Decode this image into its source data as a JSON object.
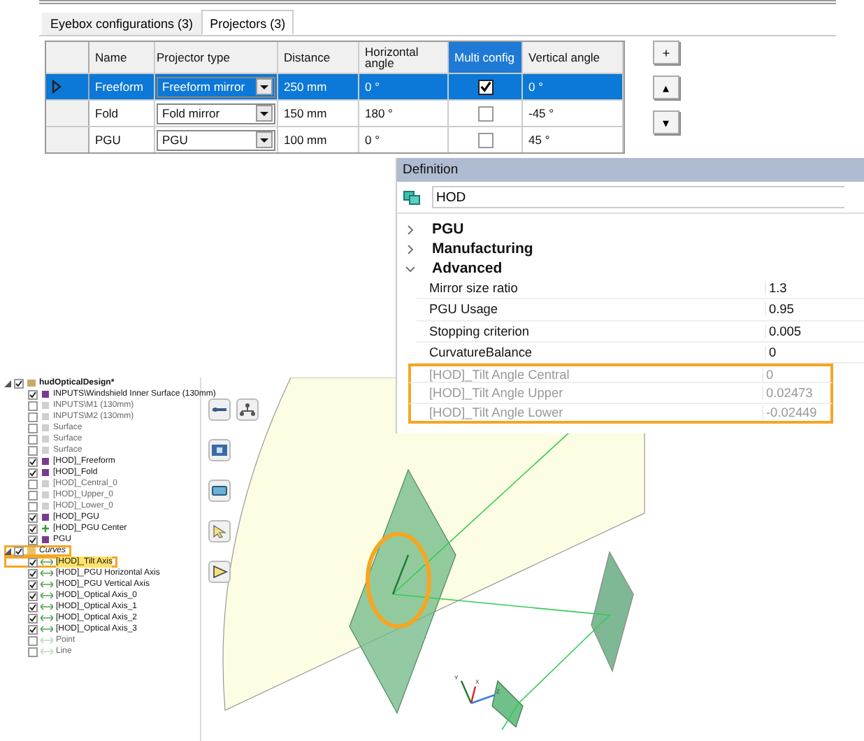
{
  "projectors_panel": {
    "tabs": [
      {
        "label": "Eyebox configurations (3)",
        "selected": false
      },
      {
        "label": "Projectors (3)",
        "selected": true
      }
    ],
    "columns": [
      {
        "label": "Name",
        "selected": false
      },
      {
        "label": "Projector type",
        "selected": false
      },
      {
        "label": "Distance",
        "selected": false
      },
      {
        "label": "Horizontal angle",
        "selected": false
      },
      {
        "label": "Multi config",
        "selected": true
      },
      {
        "label": "Vertical angle",
        "selected": false
      }
    ],
    "rows": [
      {
        "selected": true,
        "name": "Freeform",
        "type": "Freeform mirror",
        "distance": "250 mm",
        "horizontal_angle": "0 °",
        "multi_config": true,
        "vertical_angle": "0 °"
      },
      {
        "selected": false,
        "name": "Fold",
        "type": "Fold mirror",
        "distance": "150 mm",
        "horizontal_angle": "180 °",
        "multi_config": false,
        "vertical_angle": "-45 °"
      },
      {
        "selected": false,
        "name": "PGU",
        "type": "PGU",
        "distance": "100 mm",
        "horizontal_angle": "0 °",
        "multi_config": false,
        "vertical_angle": "45 °"
      }
    ],
    "side_buttons": [
      "+",
      "▴",
      "▾"
    ]
  },
  "definition_panel": {
    "title": "Definition",
    "name_field": "HOD",
    "groups": [
      {
        "label": "PGU",
        "expanded": false
      },
      {
        "label": "Manufacturing",
        "expanded": false
      },
      {
        "label": "Advanced",
        "expanded": true,
        "properties": [
          {
            "label": "Mirror size ratio",
            "value": "1.3",
            "disabled": false,
            "highlighted": false
          },
          {
            "label": "PGU Usage",
            "value": "0.95",
            "disabled": false,
            "highlighted": false
          },
          {
            "label": "Stopping criterion",
            "value": "0.005",
            "disabled": false,
            "highlighted": false
          },
          {
            "label": "CurvatureBalance",
            "value": "0",
            "disabled": false,
            "highlighted": false
          },
          {
            "label": "[HOD]_Tilt Angle Central",
            "value": "0",
            "disabled": true,
            "highlighted": true
          },
          {
            "label": "[HOD]_Tilt Angle Upper",
            "value": "0.02473",
            "disabled": true,
            "highlighted": true
          },
          {
            "label": "[HOD]_Tilt Angle Lower",
            "value": "-0.02449",
            "disabled": true,
            "highlighted": true
          }
        ]
      }
    ]
  },
  "tree": [
    {
      "label": "hudOpticalDesign*",
      "checked": true,
      "expanded": true,
      "kind": "document",
      "selected": false,
      "highlighted": false,
      "children": [
        {
          "label": "INPUTS\\Windshield Inner Surface (130mm)",
          "checked": true,
          "kind": "surface",
          "selected": false,
          "highlighted": false
        },
        {
          "label": "INPUTS\\M1 (130mm)",
          "checked": false,
          "kind": "surface",
          "selected": false,
          "highlighted": false
        },
        {
          "label": "INPUTS\\M2 (130mm)",
          "checked": false,
          "kind": "surface",
          "selected": false,
          "highlighted": false
        },
        {
          "label": "Surface",
          "checked": false,
          "kind": "surface",
          "selected": false,
          "highlighted": false
        },
        {
          "label": "Surface",
          "checked": false,
          "kind": "surface",
          "selected": false,
          "highlighted": false
        },
        {
          "label": "Surface",
          "checked": false,
          "kind": "surface",
          "selected": false,
          "highlighted": false
        },
        {
          "label": "[HOD]_Freeform",
          "checked": true,
          "kind": "surface",
          "selected": false,
          "highlighted": false
        },
        {
          "label": "[HOD]_Fold",
          "checked": true,
          "kind": "surface",
          "selected": false,
          "highlighted": false
        },
        {
          "label": "[HOD]_Central_0",
          "checked": false,
          "kind": "plane",
          "selected": false,
          "highlighted": false
        },
        {
          "label": "[HOD]_Upper_0",
          "checked": false,
          "kind": "plane",
          "selected": false,
          "highlighted": false
        },
        {
          "label": "[HOD]_Lower_0",
          "checked": false,
          "kind": "plane",
          "selected": false,
          "highlighted": false
        },
        {
          "label": "[HOD]_PGU",
          "checked": true,
          "kind": "surface",
          "selected": false,
          "highlighted": false
        },
        {
          "label": "[HOD]_PGU Center",
          "checked": true,
          "kind": "point",
          "selected": false,
          "highlighted": false
        },
        {
          "label": "PGU",
          "checked": true,
          "kind": "surface",
          "selected": false,
          "highlighted": false
        }
      ]
    },
    {
      "label": "Curves",
      "checked": true,
      "expanded": true,
      "kind": "folder",
      "selected": false,
      "highlighted": true,
      "children": [
        {
          "label": "[HOD]_Tilt Axis",
          "checked": true,
          "kind": "curve",
          "selected": true,
          "highlighted": true
        },
        {
          "label": "[HOD]_PGU Horizontal Axis",
          "checked": true,
          "kind": "curve",
          "selected": false,
          "highlighted": false
        },
        {
          "label": "[HOD]_PGU Vertical Axis",
          "checked": true,
          "kind": "curve",
          "selected": false,
          "highlighted": false
        },
        {
          "label": "[HOD]_Optical Axis_0",
          "checked": true,
          "kind": "curve",
          "selected": false,
          "highlighted": false
        },
        {
          "label": "[HOD]_Optical Axis_1",
          "checked": true,
          "kind": "curve",
          "selected": false,
          "highlighted": false
        },
        {
          "label": "[HOD]_Optical Axis_2",
          "checked": true,
          "kind": "curve",
          "selected": false,
          "highlighted": false
        },
        {
          "label": "[HOD]_Optical Axis_3",
          "checked": true,
          "kind": "curve",
          "selected": false,
          "highlighted": false
        },
        {
          "label": "Point",
          "checked": false,
          "kind": "curve",
          "selected": false,
          "highlighted": false
        },
        {
          "label": "Line",
          "checked": false,
          "kind": "curve",
          "selected": false,
          "highlighted": false
        }
      ]
    }
  ],
  "viewport": {
    "axis_labels": [
      "Y",
      "X",
      "Z"
    ]
  }
}
